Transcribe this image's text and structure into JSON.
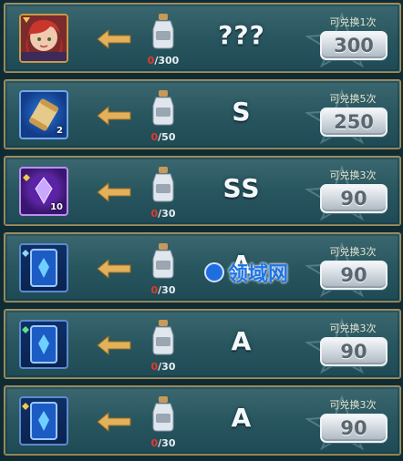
{
  "rows": [
    {
      "item": {
        "type": "hero-portrait-red-hair",
        "qty": ""
      },
      "cost_have": "0",
      "cost_need": "/300",
      "grade": "???",
      "limit": "可兑换1次",
      "price": "300"
    },
    {
      "item": {
        "type": "scroll",
        "qty": "2"
      },
      "cost_have": "0",
      "cost_need": "/50",
      "grade": "S",
      "limit": "可兑换5次",
      "price": "250"
    },
    {
      "item": {
        "type": "purple-crystal",
        "qty": "10"
      },
      "cost_have": "0",
      "cost_need": "/30",
      "grade": "SS",
      "limit": "可兑换3次",
      "price": "90"
    },
    {
      "item": {
        "type": "blue-card",
        "qty": ""
      },
      "cost_have": "0",
      "cost_need": "/30",
      "grade": "A",
      "limit": "可兑换3次",
      "price": "90"
    },
    {
      "item": {
        "type": "blue-card",
        "qty": ""
      },
      "cost_have": "0",
      "cost_need": "/30",
      "grade": "A",
      "limit": "可兑换3次",
      "price": "90"
    },
    {
      "item": {
        "type": "blue-card",
        "qty": ""
      },
      "cost_have": "0",
      "cost_need": "/30",
      "grade": "A",
      "limit": "可兑换3次",
      "price": "90"
    }
  ],
  "watermark": {
    "text": "领域网"
  },
  "colors": {
    "cost_have": "#e03a2e",
    "accent_gold": "#d6a24e",
    "panel": "#2b5a63"
  }
}
